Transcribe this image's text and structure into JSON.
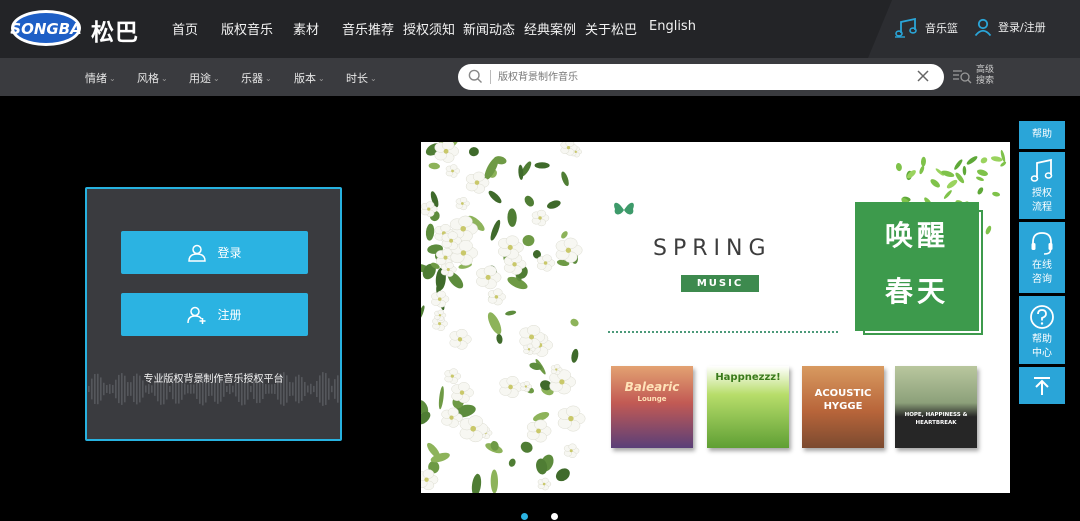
{
  "brand": {
    "logo_text": "SONGBA",
    "name_cn": "松巴"
  },
  "nav": [
    {
      "label": "首页"
    },
    {
      "label": "版权音乐"
    },
    {
      "label": "素材"
    },
    {
      "label": "音乐推荐"
    },
    {
      "label": "授权须知"
    },
    {
      "label": "新闻动态"
    },
    {
      "label": "经典案例"
    },
    {
      "label": "关于松巴"
    },
    {
      "label": "English"
    }
  ],
  "header_right": {
    "cart_label": "音乐篮",
    "login_label": "登录/注册"
  },
  "filters": [
    {
      "label": "情绪"
    },
    {
      "label": "风格"
    },
    {
      "label": "用途"
    },
    {
      "label": "乐器"
    },
    {
      "label": "版本"
    },
    {
      "label": "时长"
    }
  ],
  "search": {
    "placeholder": "版权背景制作音乐",
    "value": ""
  },
  "advanced_search": {
    "label": "高级搜索"
  },
  "login_panel": {
    "login_button": "登录",
    "register_button": "注册",
    "tagline": "专业版权背景制作音乐授权平台"
  },
  "banner": {
    "spring_title": "SPRING",
    "music_tag": "MUSIC",
    "wake_line1": "唤醒",
    "wake_line2": "春天",
    "albums": [
      {
        "title": "Balearic",
        "subtitle": "Lounge",
        "bg": "#c76a4a"
      },
      {
        "title": "Happnezzz!",
        "subtitle": "",
        "bg": "#7fb24a"
      },
      {
        "title": "ACOUSTIC",
        "subtitle": "HYGGE",
        "bg": "#b86a3e"
      },
      {
        "title": "HOPE, HAPPINESS &",
        "subtitle": "HEARTBREAK",
        "bg": "#7a8f6a"
      }
    ]
  },
  "sidebar": {
    "help": "帮助",
    "license_flow_1": "授权",
    "license_flow_2": "流程",
    "online_1": "在线",
    "online_2": "咨询",
    "help_center_1": "帮助",
    "help_center_2": "中心"
  },
  "carousel": {
    "count": 2,
    "active": 1
  },
  "colors": {
    "accent": "#2bb3e2",
    "green": "#3d9a4c",
    "header": "#232427",
    "filterbar": "#3a3b3f"
  }
}
